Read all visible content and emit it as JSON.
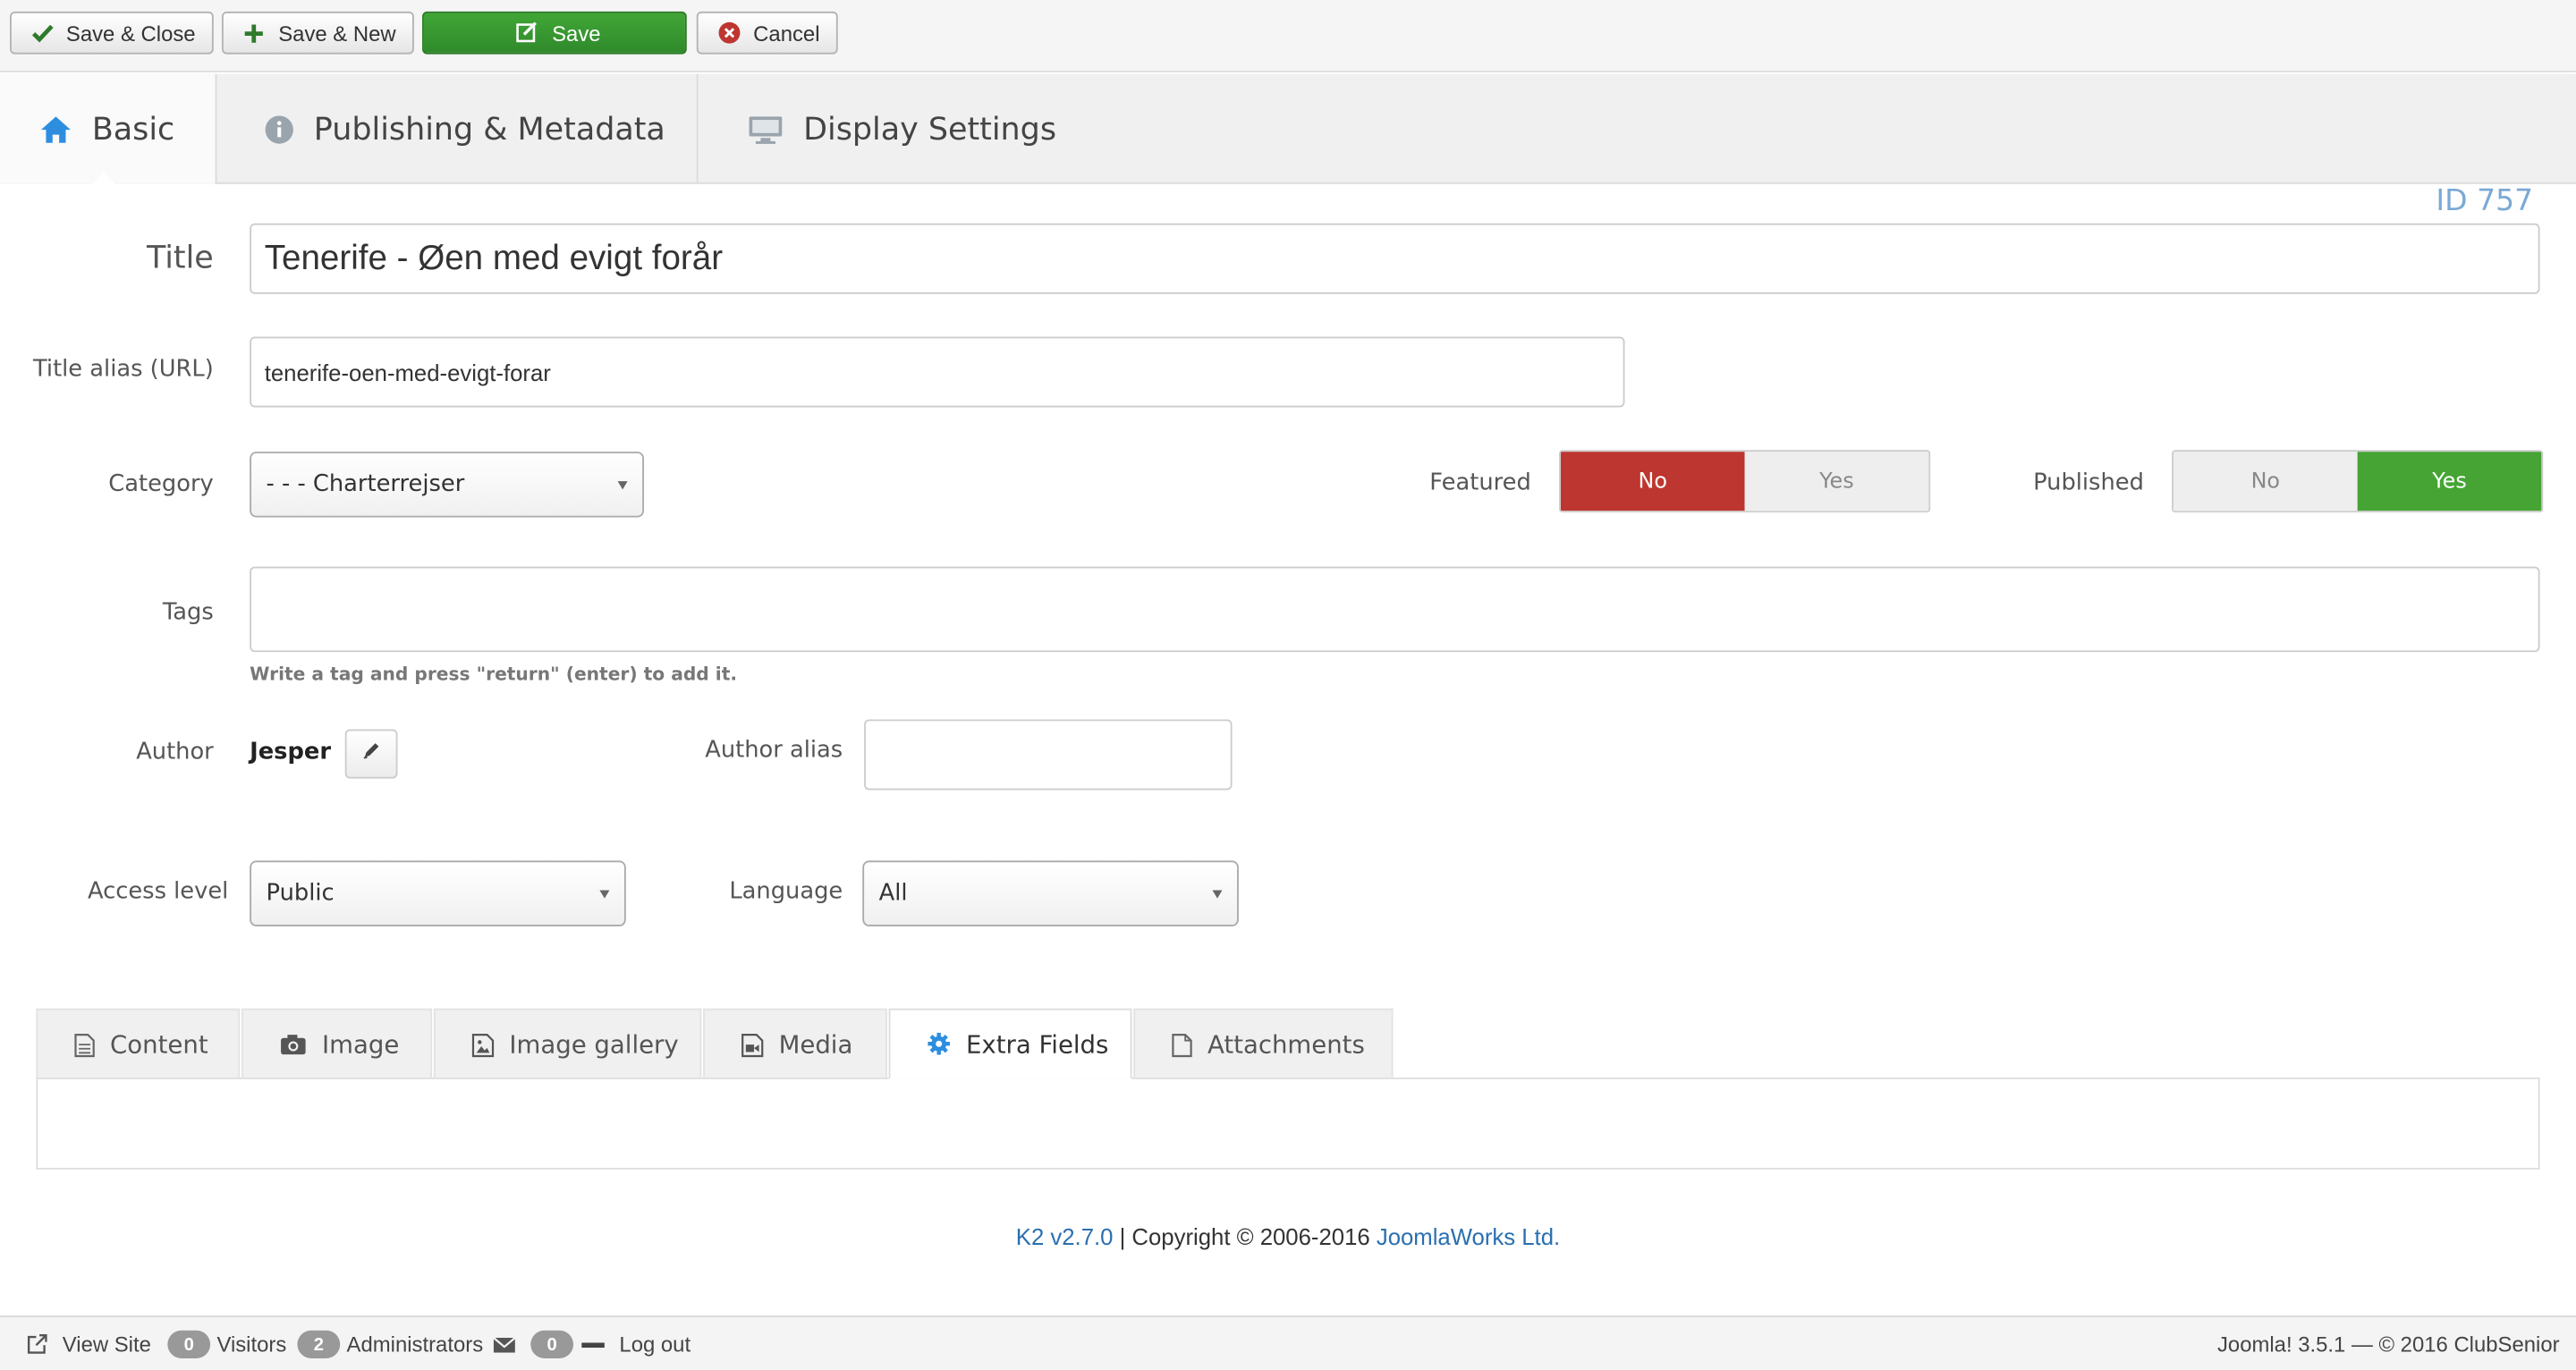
{
  "toolbar": {
    "save_close": "Save & Close",
    "save_new": "Save & New",
    "save": "Save",
    "cancel": "Cancel"
  },
  "tabs": {
    "basic": "Basic",
    "publishing": "Publishing & Metadata",
    "display": "Display Settings",
    "id_label": "ID 757"
  },
  "form": {
    "title_label": "Title",
    "title_value": "Tenerife - Øen med evigt forår",
    "alias_label": "Title alias (URL)",
    "alias_value": "tenerife-oen-med-evigt-forar",
    "category_label": "Category",
    "category_value": "- - - Charterrejser",
    "featured_label": "Featured",
    "featured_no": "No",
    "featured_yes": "Yes",
    "published_label": "Published",
    "published_no": "No",
    "published_yes": "Yes",
    "tags_label": "Tags",
    "tags_hint": "Write a tag and press \"return\" (enter) to add it.",
    "author_label": "Author",
    "author_value": "Jesper",
    "author_alias_label": "Author alias",
    "author_alias_value": "",
    "access_label": "Access level",
    "access_value": "Public",
    "language_label": "Language",
    "language_value": "All"
  },
  "content_tabs": {
    "content": "Content",
    "image": "Image",
    "gallery": "Image gallery",
    "media": "Media",
    "extra": "Extra Fields",
    "attachments": "Attachments"
  },
  "footer": {
    "k2": "K2 v2.7.0",
    "sep": " | Copyright © 2006-2016 ",
    "company": "JoomlaWorks Ltd."
  },
  "statusbar": {
    "view_site": "View Site",
    "visitors_count": "0",
    "visitors": "Visitors",
    "admins_count": "2",
    "admins": "Administrators",
    "messages_count": "0",
    "logout": "Log out",
    "version": "Joomla! 3.5.1  —  © 2016 ClubSenior"
  },
  "colors": {
    "save_green": "#2f8a2b",
    "featured_no_red": "#bd362f",
    "published_yes_green": "#46a434",
    "id_blue": "#7aa9d4",
    "link_blue": "#2a6fb0",
    "icon_blue": "#2d8ee0"
  }
}
